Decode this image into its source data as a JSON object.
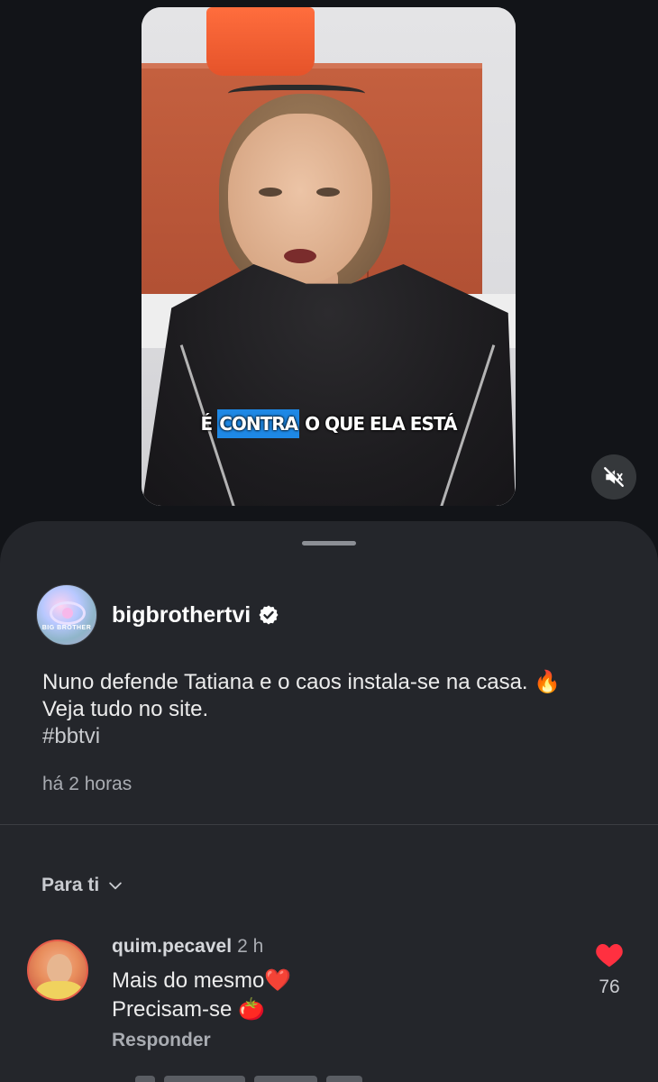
{
  "video": {
    "subtitle_prefix": "É",
    "subtitle_highlight": "CONTRA",
    "subtitle_rest": "O QUE ELA ESTÁ",
    "muted": true
  },
  "post": {
    "username": "bigbrothertvi",
    "verified": true,
    "avatar_text": "BIG BROTHER",
    "caption_line1": "Nuno defende Tatiana e o caos instala-se na casa. 🔥",
    "caption_line2": "Veja tudo no site.",
    "hashtag": "#bbtvi",
    "timestamp": "há 2 horas"
  },
  "comments_filter": {
    "label": "Para ti"
  },
  "comments": [
    {
      "username": "quim.pecavel",
      "time": "2 h",
      "line1": "Mais do mesmo❤️",
      "line2": "Precisam-se 🍅",
      "reply_label": "Responder",
      "likes": "76",
      "like_icon": "heart-filled"
    }
  ],
  "colors": {
    "background": "#121418",
    "sheet": "#24262b",
    "like": "#ff3040",
    "subtitle_highlight": "#1e88e5",
    "verified_badge": "#ffffff"
  }
}
